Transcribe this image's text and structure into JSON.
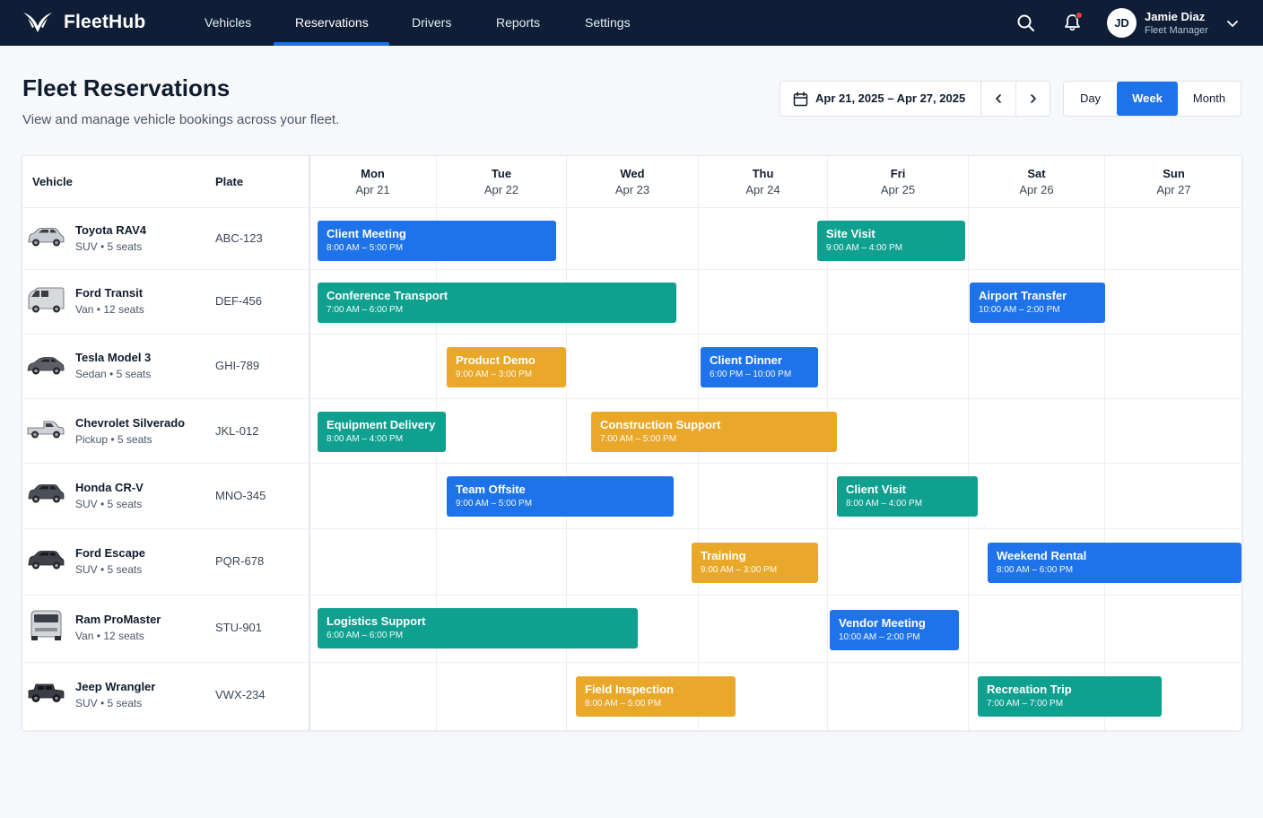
{
  "brand": {
    "name": "FleetHub"
  },
  "nav": {
    "items": [
      {
        "label": "Vehicles"
      },
      {
        "label": "Reservations"
      },
      {
        "label": "Drivers"
      },
      {
        "label": "Reports"
      },
      {
        "label": "Settings"
      }
    ],
    "active": "Reservations"
  },
  "user": {
    "initials": "JD",
    "name": "Jamie Diaz",
    "role": "Fleet Manager"
  },
  "header": {
    "title": "Fleet Reservations",
    "subtitle": "View and manage vehicle bookings across your fleet."
  },
  "date_range": {
    "label": "Apr 21, 2025 – Apr 27, 2025"
  },
  "views": {
    "day": "Day",
    "week": "Week",
    "month": "Month",
    "active": "Week"
  },
  "table": {
    "col_vehicle": "Vehicle",
    "col_plate": "Plate",
    "days": [
      {
        "name": "Mon",
        "date": "Apr 21"
      },
      {
        "name": "Tue",
        "date": "Apr 22"
      },
      {
        "name": "Wed",
        "date": "Apr 23"
      },
      {
        "name": "Thu",
        "date": "Apr 24"
      },
      {
        "name": "Fri",
        "date": "Apr 25"
      },
      {
        "name": "Sat",
        "date": "Apr 26"
      },
      {
        "name": "Sun",
        "date": "Apr 27"
      }
    ],
    "rows": [
      {
        "name": "Toyota RAV4",
        "meta": "SUV • 5 seats",
        "plate": "ABC-123",
        "icon": "suv-icon"
      },
      {
        "name": "Ford Transit",
        "meta": "Van • 12 seats",
        "plate": "DEF-456",
        "icon": "van-icon"
      },
      {
        "name": "Tesla Model 3",
        "meta": "Sedan • 5 seats",
        "plate": "GHI-789",
        "icon": "sedan-icon"
      },
      {
        "name": "Chevrolet Silverado",
        "meta": "Pickup • 5 seats",
        "plate": "JKL-012",
        "icon": "pickup-icon"
      },
      {
        "name": "Honda CR-V",
        "meta": "SUV • 5 seats",
        "plate": "MNO-345",
        "icon": "suv-icon"
      },
      {
        "name": "Ford Escape",
        "meta": "SUV • 5 seats",
        "plate": "PQR-678",
        "icon": "suv-icon"
      },
      {
        "name": "Ram ProMaster",
        "meta": "Van • 12 seats",
        "plate": "STU-901",
        "icon": "van-icon"
      },
      {
        "name": "Jeep Wrangler",
        "meta": "SUV • 5 seats",
        "plate": "VWX-234",
        "icon": "suv-icon"
      }
    ]
  },
  "bookings": [
    {
      "title": "Client Meeting",
      "time": "8:00 AM – 5:00 PM",
      "color": "#1f73ea"
    },
    {
      "title": "Site Visit",
      "time": "9:00 AM – 4:00 PM",
      "color": "#0fa08f"
    },
    {
      "title": "Conference Transport",
      "time": "7:00 AM – 6:00 PM",
      "color": "#0fa08f"
    },
    {
      "title": "Airport Transfer",
      "time": "10:00 AM – 2:00 PM",
      "color": "#1f73ea"
    },
    {
      "title": "Product Demo",
      "time": "9:00 AM – 3:00 PM",
      "color": "#e9a82a"
    },
    {
      "title": "Client Dinner",
      "time": "6:00 PM – 10:00 PM",
      "color": "#1f73ea"
    },
    {
      "title": "Equipment Delivery",
      "time": "8:00 AM – 4:00 PM",
      "color": "#0fa08f"
    },
    {
      "title": "Construction Support",
      "time": "7:00 AM – 5:00 PM",
      "color": "#e9a82a"
    },
    {
      "title": "Team Offsite",
      "time": "9:00 AM – 5:00 PM",
      "color": "#1f73ea"
    },
    {
      "title": "Client Visit",
      "time": "8:00 AM – 4:00 PM",
      "color": "#0fa08f"
    },
    {
      "title": "Training",
      "time": "9:00 AM – 3:00 PM",
      "color": "#e9a82a"
    },
    {
      "title": "Weekend Rental",
      "time": "8:00 AM – 6:00 PM",
      "color": "#1f73ea"
    },
    {
      "title": "Logistics Support",
      "time": "6:00 AM – 6:00 PM",
      "color": "#0fa08f"
    },
    {
      "title": "Vendor Meeting",
      "time": "10:00 AM – 2:00 PM",
      "color": "#1f73ea"
    },
    {
      "title": "Field Inspection",
      "time": "8:00 AM – 5:00 PM",
      "color": "#e9a82a"
    },
    {
      "title": "Recreation Trip",
      "time": "7:00 AM – 7:00 PM",
      "color": "#0fa08f"
    }
  ],
  "colors": {
    "nav_bg": "#0f1e36",
    "accent": "#1f73ea",
    "teal": "#0fa08f",
    "amber": "#e9a82a",
    "notification": "#ef3b3b"
  }
}
